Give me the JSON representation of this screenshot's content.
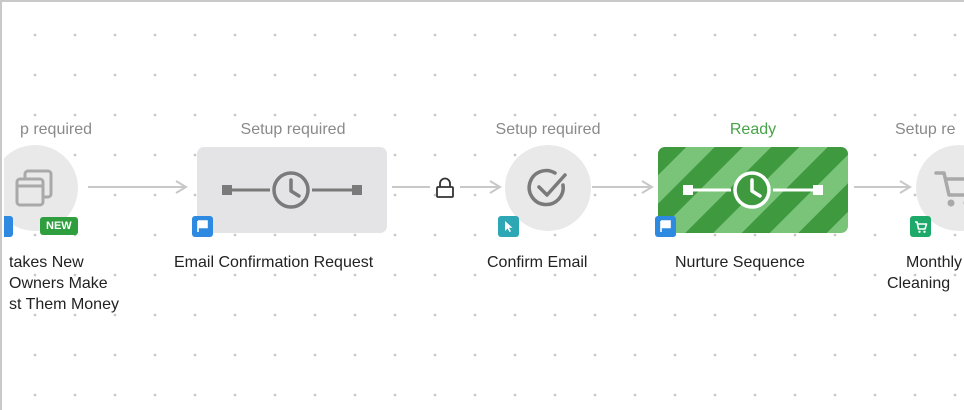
{
  "steps": [
    {
      "status": "p required",
      "title_lines": [
        "takes New",
        "Owners Make",
        "st Them Money"
      ],
      "icon": "pages-icon",
      "badge": "flag-icon",
      "tag": "NEW"
    },
    {
      "status": "Setup required",
      "title": "Email Confirmation Request",
      "icon": "delay-clock-icon",
      "badge": "flag-icon"
    },
    {
      "status": "Setup required",
      "title": "Confirm Email",
      "icon": "check-circle-icon",
      "badge": "cursor-icon"
    },
    {
      "status": "Ready",
      "title": "Nurture Sequence",
      "icon": "delay-clock-icon",
      "badge": "flag-icon"
    },
    {
      "status": "Setup re",
      "title_lines": [
        "Monthly",
        "Cleaning"
      ],
      "icon": "cart-icon",
      "badge": "cart-icon"
    }
  ],
  "connector_lock": "lock-icon",
  "colors": {
    "ready_green": "#47a347",
    "ready_stripe_dark": "#3f9a3f",
    "ready_stripe_light": "#7ac47a",
    "badge_blue": "#2d8ae0",
    "badge_teal": "#2ca7b3",
    "badge_green": "#1da96a",
    "new_green": "#2e9e3e"
  }
}
